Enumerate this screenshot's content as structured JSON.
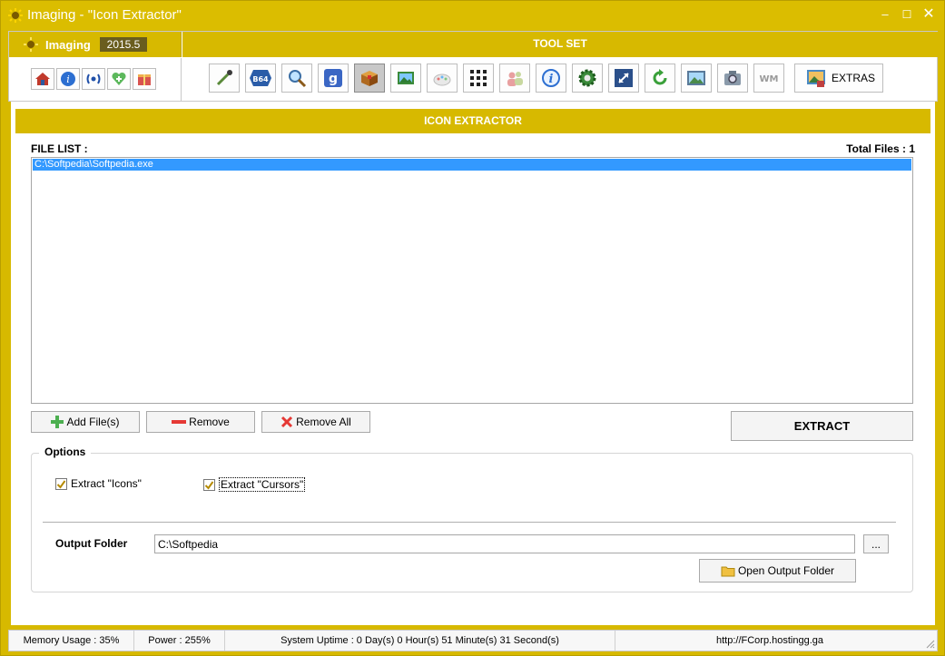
{
  "window": {
    "title": "Imaging - \"Icon Extractor\"",
    "controls": {
      "minimize": "‒",
      "maximize": "☐",
      "close": "✕"
    },
    "accent_color": "#d7b900"
  },
  "brand": {
    "name": "Imaging",
    "version": "2015.5"
  },
  "toolset": {
    "header": "TOOL SET",
    "nav_icons": [
      "home-icon",
      "info-icon",
      "broadcast-icon",
      "health-icon",
      "gift-icon"
    ],
    "tool_icons": [
      "dropper-icon",
      "base64-icon",
      "magnifier-icon",
      "google-icon",
      "box-icon",
      "image-convert-icon",
      "paint-icon",
      "grid-icon",
      "people-icon",
      "info-circle-icon",
      "gear-icon",
      "resize-icon",
      "refresh-icon",
      "picture-icon",
      "camera-icon",
      "watermark-icon"
    ],
    "base64_text": "B64",
    "google_text": "g",
    "watermark_text": "WM",
    "extras_label": "EXTRAS"
  },
  "section": {
    "title": "ICON EXTRACTOR"
  },
  "file_list": {
    "label": "FILE LIST :",
    "total_label": "Total Files : 1",
    "items": [
      "C:\\Softpedia\\Softpedia.exe"
    ]
  },
  "buttons": {
    "add": "Add File(s)",
    "remove": "Remove",
    "remove_all": "Remove All",
    "extract": "EXTRACT"
  },
  "options": {
    "legend": "Options",
    "extract_icons": "Extract \"Icons\"",
    "extract_cursors": "Extract \"Cursors\"",
    "output_label": "Output Folder",
    "output_value": "C:\\Softpedia",
    "browse": "...",
    "open_folder": "Open Output Folder"
  },
  "status": {
    "memory": "Memory Usage : 35%",
    "power": "Power : 255%",
    "uptime": "System Uptime : 0 Day(s) 0 Hour(s) 51 Minute(s) 31 Second(s)",
    "url": "http://FCorp.hostingg.ga"
  }
}
